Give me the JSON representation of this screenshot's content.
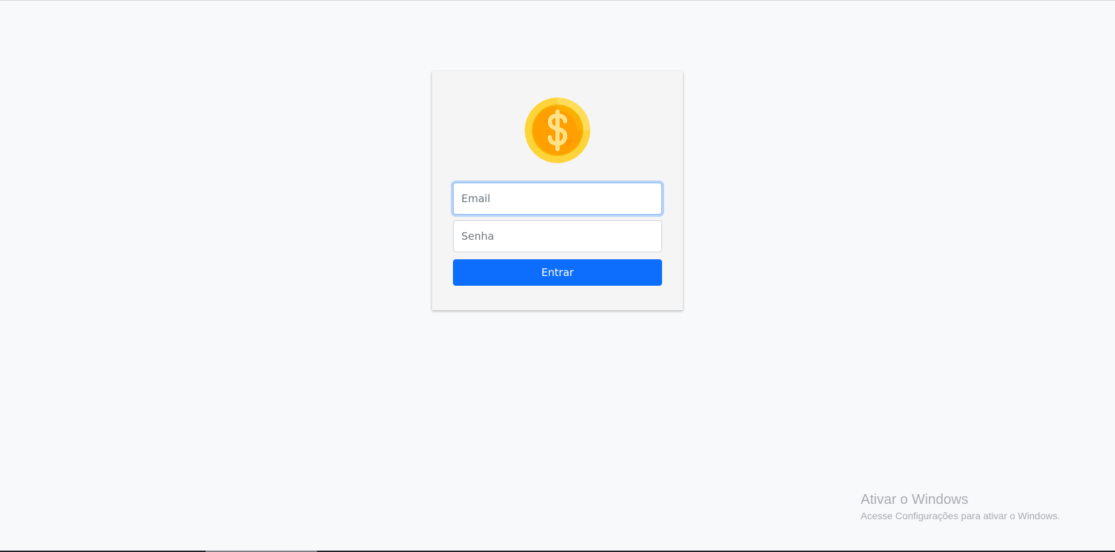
{
  "login": {
    "email_placeholder": "Email",
    "password_placeholder": "Senha",
    "submit_label": "Entrar"
  },
  "watermark": {
    "title": "Ativar o Windows",
    "subtitle": "Acesse Configurações para ativar o Windows."
  },
  "icons": {
    "logo": "coin-dollar-icon"
  },
  "colors": {
    "page_background": "#f8f9fa",
    "card_background": "#f5f5f5",
    "primary_button": "#0d6efd",
    "focus_ring": "#86b7fe",
    "coin_outer": "#ffd43b",
    "coin_inner": "#ff9f00"
  }
}
